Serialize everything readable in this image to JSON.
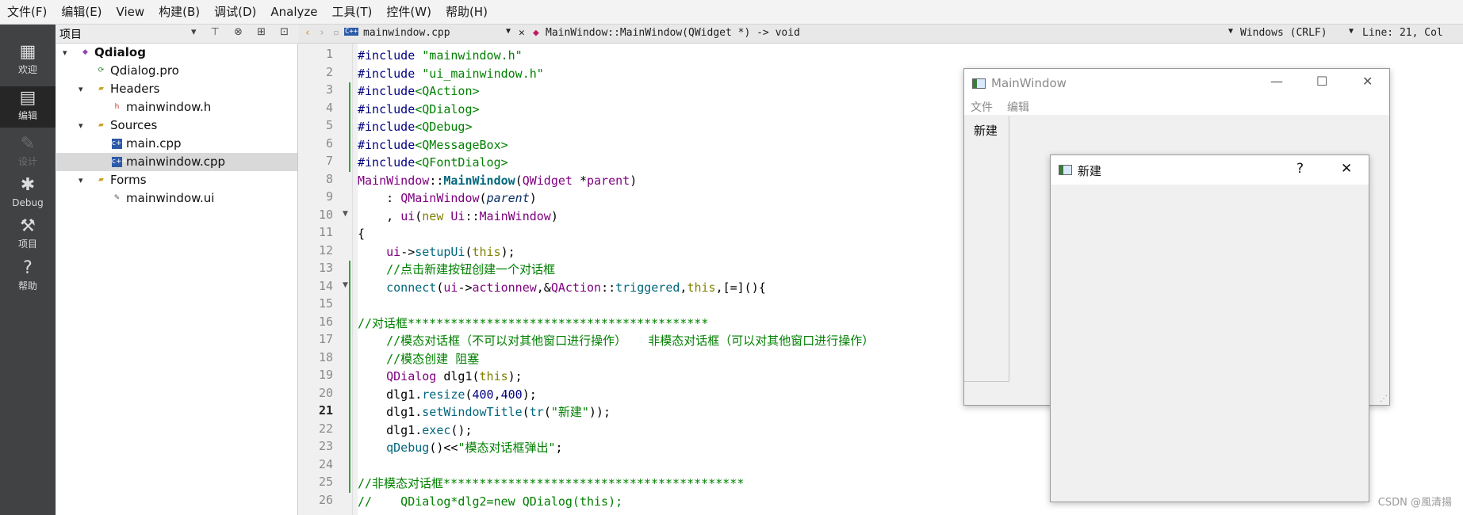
{
  "menu": [
    "文件(F)",
    "编辑(E)",
    "View",
    "构建(B)",
    "调试(D)",
    "Analyze",
    "工具(T)",
    "控件(W)",
    "帮助(H)"
  ],
  "modes": [
    {
      "label": "欢迎",
      "icon": "grid-icon"
    },
    {
      "label": "编辑",
      "icon": "document-icon"
    },
    {
      "label": "设计",
      "icon": "pencil-icon"
    },
    {
      "label": "Debug",
      "icon": "bug-icon"
    },
    {
      "label": "项目",
      "icon": "wrench-icon"
    },
    {
      "label": "帮助",
      "icon": "help-icon"
    }
  ],
  "tree": {
    "header": "项目",
    "items": [
      {
        "label": "Qdialog",
        "level": 0,
        "expanded": true,
        "icon": "project-icon",
        "bold": true
      },
      {
        "label": "Qdialog.pro",
        "level": 1,
        "icon": "pro-file-icon"
      },
      {
        "label": "Headers",
        "level": 1,
        "expanded": true,
        "icon": "folder-icon"
      },
      {
        "label": "mainwindow.h",
        "level": 2,
        "icon": "header-file-icon"
      },
      {
        "label": "Sources",
        "level": 1,
        "expanded": true,
        "icon": "folder-icon"
      },
      {
        "label": "main.cpp",
        "level": 2,
        "icon": "cpp-file-icon"
      },
      {
        "label": "mainwindow.cpp",
        "level": 2,
        "icon": "cpp-file-icon",
        "selected": true
      },
      {
        "label": "Forms",
        "level": 1,
        "expanded": true,
        "icon": "folder-icon"
      },
      {
        "label": "mainwindow.ui",
        "level": 2,
        "icon": "ui-file-icon"
      }
    ]
  },
  "editor": {
    "file": "mainwindow.cpp",
    "symbol": "MainWindow::MainWindow(QWidget *) -> void",
    "encoding": "Windows (CRLF)",
    "position": "Line: 21, Col",
    "current_line": 21,
    "lines": [
      [
        [
          "c-dir",
          "#include "
        ],
        [
          "c-str",
          "\"mainwindow.h\""
        ]
      ],
      [
        [
          "c-dir",
          "#include "
        ],
        [
          "c-str",
          "\"ui_mainwindow.h\""
        ]
      ],
      [
        [
          "c-dir",
          "#include"
        ],
        [
          "c-str",
          "<QAction>"
        ]
      ],
      [
        [
          "c-dir",
          "#include"
        ],
        [
          "c-str",
          "<QDialog>"
        ]
      ],
      [
        [
          "c-dir",
          "#include"
        ],
        [
          "c-str",
          "<QDebug>"
        ]
      ],
      [
        [
          "c-dir",
          "#include"
        ],
        [
          "c-str",
          "<QMessageBox>"
        ]
      ],
      [
        [
          "c-dir",
          "#include"
        ],
        [
          "c-str",
          "<QFontDialog>"
        ]
      ],
      [
        [
          "c-typ",
          "MainWindow"
        ],
        [
          "",
          "::"
        ],
        [
          "c-fnb",
          "MainWindow"
        ],
        [
          "",
          "("
        ],
        [
          "c-typ",
          "QWidget"
        ],
        [
          "",
          " *"
        ],
        [
          "c-typ",
          "parent"
        ],
        [
          "",
          ")"
        ]
      ],
      [
        [
          "",
          "    : "
        ],
        [
          "c-typ",
          "QMainWindow"
        ],
        [
          "",
          "("
        ],
        [
          "c-par",
          "parent"
        ],
        [
          "",
          ")"
        ]
      ],
      [
        [
          "",
          "    , "
        ],
        [
          "c-typ",
          "ui"
        ],
        [
          "",
          "("
        ],
        [
          "c-kw",
          "new"
        ],
        [
          "",
          " "
        ],
        [
          "c-typ",
          "Ui"
        ],
        [
          "",
          "::"
        ],
        [
          "c-typ",
          "MainWindow"
        ],
        [
          "",
          ")"
        ]
      ],
      [
        [
          "",
          "{"
        ]
      ],
      [
        [
          "",
          "    "
        ],
        [
          "c-typ",
          "ui"
        ],
        [
          "",
          "->"
        ],
        [
          "c-fn",
          "setupUi"
        ],
        [
          "",
          "("
        ],
        [
          "c-kw",
          "this"
        ],
        [
          "",
          ");"
        ]
      ],
      [
        [
          "c-cmt",
          "    //点击新建按钮创建一个对话框"
        ]
      ],
      [
        [
          "",
          "    "
        ],
        [
          "c-fn",
          "connect"
        ],
        [
          "",
          "("
        ],
        [
          "c-typ",
          "ui"
        ],
        [
          "",
          "->"
        ],
        [
          "c-typ",
          "actionnew"
        ],
        [
          "",
          ",&"
        ],
        [
          "c-typ",
          "QAction"
        ],
        [
          "",
          "::"
        ],
        [
          "c-fn",
          "triggered"
        ],
        [
          "",
          ","
        ],
        [
          "c-kw",
          "this"
        ],
        [
          "",
          ",[=](){"
        ]
      ],
      [
        [
          "",
          ""
        ]
      ],
      [
        [
          "c-cmt",
          "//对话框******************************************"
        ]
      ],
      [
        [
          "c-cmt",
          "    //模态对话框（不可以对其他窗口进行操作）   非模态对话框（可以对其他窗口进行操作）"
        ]
      ],
      [
        [
          "c-cmt",
          "    //模态创建 阻塞"
        ]
      ],
      [
        [
          "",
          "    "
        ],
        [
          "c-typ",
          "QDialog"
        ],
        [
          "",
          " dlg1("
        ],
        [
          "c-kw",
          "this"
        ],
        [
          "",
          ");"
        ]
      ],
      [
        [
          "",
          "    dlg1."
        ],
        [
          "c-fn",
          "resize"
        ],
        [
          "",
          "("
        ],
        [
          "c-num",
          "400"
        ],
        [
          "",
          ","
        ],
        [
          "c-num",
          "400"
        ],
        [
          "",
          ");"
        ]
      ],
      [
        [
          "",
          "    dlg1."
        ],
        [
          "c-fn",
          "setWindowTitle"
        ],
        [
          "",
          "("
        ],
        [
          "c-fn",
          "tr"
        ],
        [
          "",
          "("
        ],
        [
          "c-str",
          "\"新建\""
        ],
        [
          "",
          "));"
        ]
      ],
      [
        [
          "",
          "    dlg1."
        ],
        [
          "c-fn",
          "exec"
        ],
        [
          "",
          "();"
        ]
      ],
      [
        [
          "",
          "    "
        ],
        [
          "c-fn",
          "qDebug"
        ],
        [
          "",
          "()<<"
        ],
        [
          "c-str",
          "\"模态对话框弹出\""
        ],
        [
          "",
          ";"
        ]
      ],
      [
        [
          "",
          ""
        ]
      ],
      [
        [
          "c-cmt",
          "//非模态对话框******************************************"
        ]
      ],
      [
        [
          "c-cmt",
          "//    QDialog*dlg2=new QDialog(this);"
        ]
      ]
    ]
  },
  "mainwindow": {
    "title": "MainWindow",
    "menus": [
      "文件",
      "编辑"
    ],
    "toolbar_action": "新建"
  },
  "dialog": {
    "title": "新建",
    "help": "?",
    "close": "✕"
  },
  "watermark": "CSDN @風清揚"
}
